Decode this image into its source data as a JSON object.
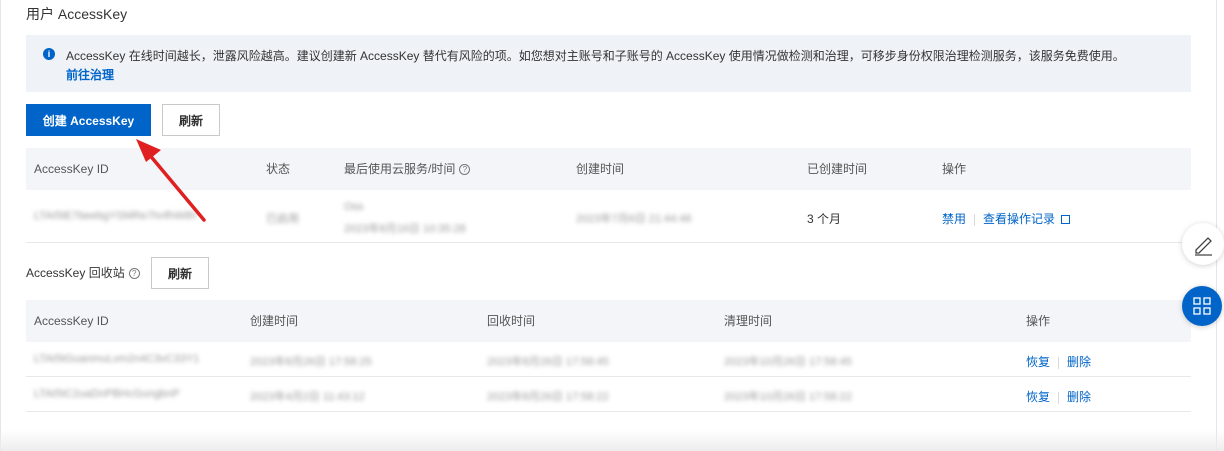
{
  "page": {
    "title": "用户 AccessKey"
  },
  "notice": {
    "text": "AccessKey 在线时间越长，泄露风险越高。建议创建新 AccessKey 替代有风险的项。如您想对主账号和子账号的 AccessKey 使用情况做检测和治理，可移步身份权限治理检测服务，该服务免费使用。",
    "link": "前往治理",
    "icon": "info-icon"
  },
  "toolbar": {
    "create_label": "创建 AccessKey",
    "refresh_label": "刷新"
  },
  "keys_table": {
    "columns": [
      "AccessKey ID",
      "状态",
      "最后使用云服务/时间",
      "创建时间",
      "已创建时间",
      "操作"
    ],
    "rows": [
      {
        "id": "LTAI5tE7beebgYSMRe7hnfhW8h",
        "status": "已启用",
        "last_used_service": "Oss",
        "last_used_time": "2023年8月16日 10:35:28",
        "created": "2023年7月6日 21:44:46",
        "age": "3 个月",
        "actions": [
          "禁用",
          "查看操作记录"
        ]
      }
    ]
  },
  "recycle": {
    "title": "AccessKey 回收站",
    "refresh_label": "刷新",
    "columns": [
      "AccessKey ID",
      "创建时间",
      "回收时间",
      "清理时间",
      "操作"
    ],
    "rows": [
      {
        "id": "LTAI5tGuanmuLvm2n4C3vC33Y1",
        "created": "2023年8月26日 17:58:25",
        "recycled": "2023年8月26日 17:58:45",
        "cleanup": "2023年10月26日 17:58:45",
        "actions": [
          "恢复",
          "删除"
        ]
      },
      {
        "id": "LTAI5tC2uaDnPBHcGungbnP",
        "created": "2023年4月2日 11:43:12",
        "recycled": "2023年8月26日 17:58:22",
        "cleanup": "2023年10月26日 17:58:22",
        "actions": [
          "恢复",
          "删除"
        ]
      }
    ]
  },
  "colors": {
    "primary": "#0064c8",
    "annotation_arrow": "#e02020",
    "table_header_bg": "#f3f5f8",
    "notice_bg": "#eff3f8"
  },
  "floating": {
    "edit_icon": "edit-pen-icon",
    "apps_icon": "apps-grid-icon"
  }
}
